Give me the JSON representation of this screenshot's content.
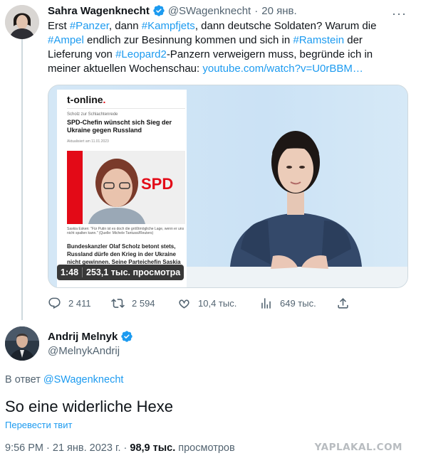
{
  "tweet1": {
    "author_name": "Sahra Wagenknecht",
    "handle": "@SWagenknecht",
    "separator": "·",
    "date": "20 янв.",
    "more": "···",
    "text": {
      "p1": "Erst ",
      "h1": "#Panzer",
      "p2": ", dann ",
      "h2": "#Kampfjets",
      "p3": ", dann deutsche Soldaten? Warum die ",
      "h3": "#Ampel",
      "p4": " endlich zur Besinnung kommen und sich in ",
      "h4": "#Ramstein",
      "p5": " der Lieferung von ",
      "h5": "#Leopard2",
      "p6": "-Panzern verweigern muss, begründe ich in meiner aktuellen Wochenschau: ",
      "link": "youtube.com/watch?v=U0rBBM…"
    },
    "media": {
      "article": {
        "logo": "t-online",
        "logo_dot": ".",
        "kicker": "Scholz zur Schlachtenrede",
        "headline": "SPD-Chefin wünscht sich Sieg der Ukraine gegen Russland",
        "date": "Aktualisiert am 11.01.2023",
        "photo_text": "SPD",
        "caption": "Saskia Esken: \"Für Putin ist es doch die größtmögliche Lage, wenn er uns nicht spalten kann.\" (Quelle: Michele Tantussi/Reuters)",
        "body": "Bundeskanzler Olaf Scholz betont stets, Russland dürfe den Krieg in der Ukraine nicht gewinnen. Seine Parteichefin Saskia"
      },
      "duration": "1:48",
      "views": "253,1 тыс. просмотра"
    },
    "actions": {
      "replies": "2 411",
      "retweets": "2 594",
      "likes": "10,4 тыс.",
      "views": "649 тыс."
    }
  },
  "tweet2": {
    "author_name": "Andrij Melnyk",
    "handle": "@MelnykAndrij",
    "reply_prefix": "В ответ",
    "reply_handle": "@SWagenknecht",
    "text": "So eine widerliche Hexe",
    "translate_label": "Перевести твит",
    "time": "9:56 PM",
    "date": "21 янв. 2023 г.",
    "views_count": "98,9 тыс.",
    "views_label": "просмотров"
  },
  "watermark": "YAPLAKAL.COM",
  "colors": {
    "accent": "#1d9bf0",
    "text": "#0f1419",
    "muted": "#536471",
    "border": "#cfd9de",
    "spd_red": "#e30a17"
  }
}
